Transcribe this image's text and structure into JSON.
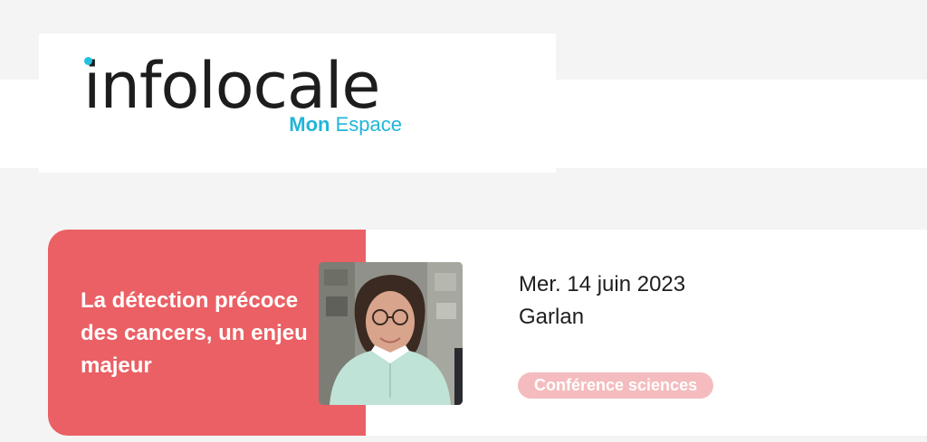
{
  "brand": {
    "name": "infolocale",
    "sub_strong": "Mon",
    "sub_rest": "Espace",
    "accent_color": "#22b5d8"
  },
  "event": {
    "title": "La détection précoce des cancers, un enjeu majeur",
    "date": "Mer. 14 juin 2023",
    "place": "Garlan",
    "tag": "Conférence sciences",
    "card_color": "#ea6064",
    "tag_color": "#f4bcbe",
    "photo_alt": "photo"
  }
}
